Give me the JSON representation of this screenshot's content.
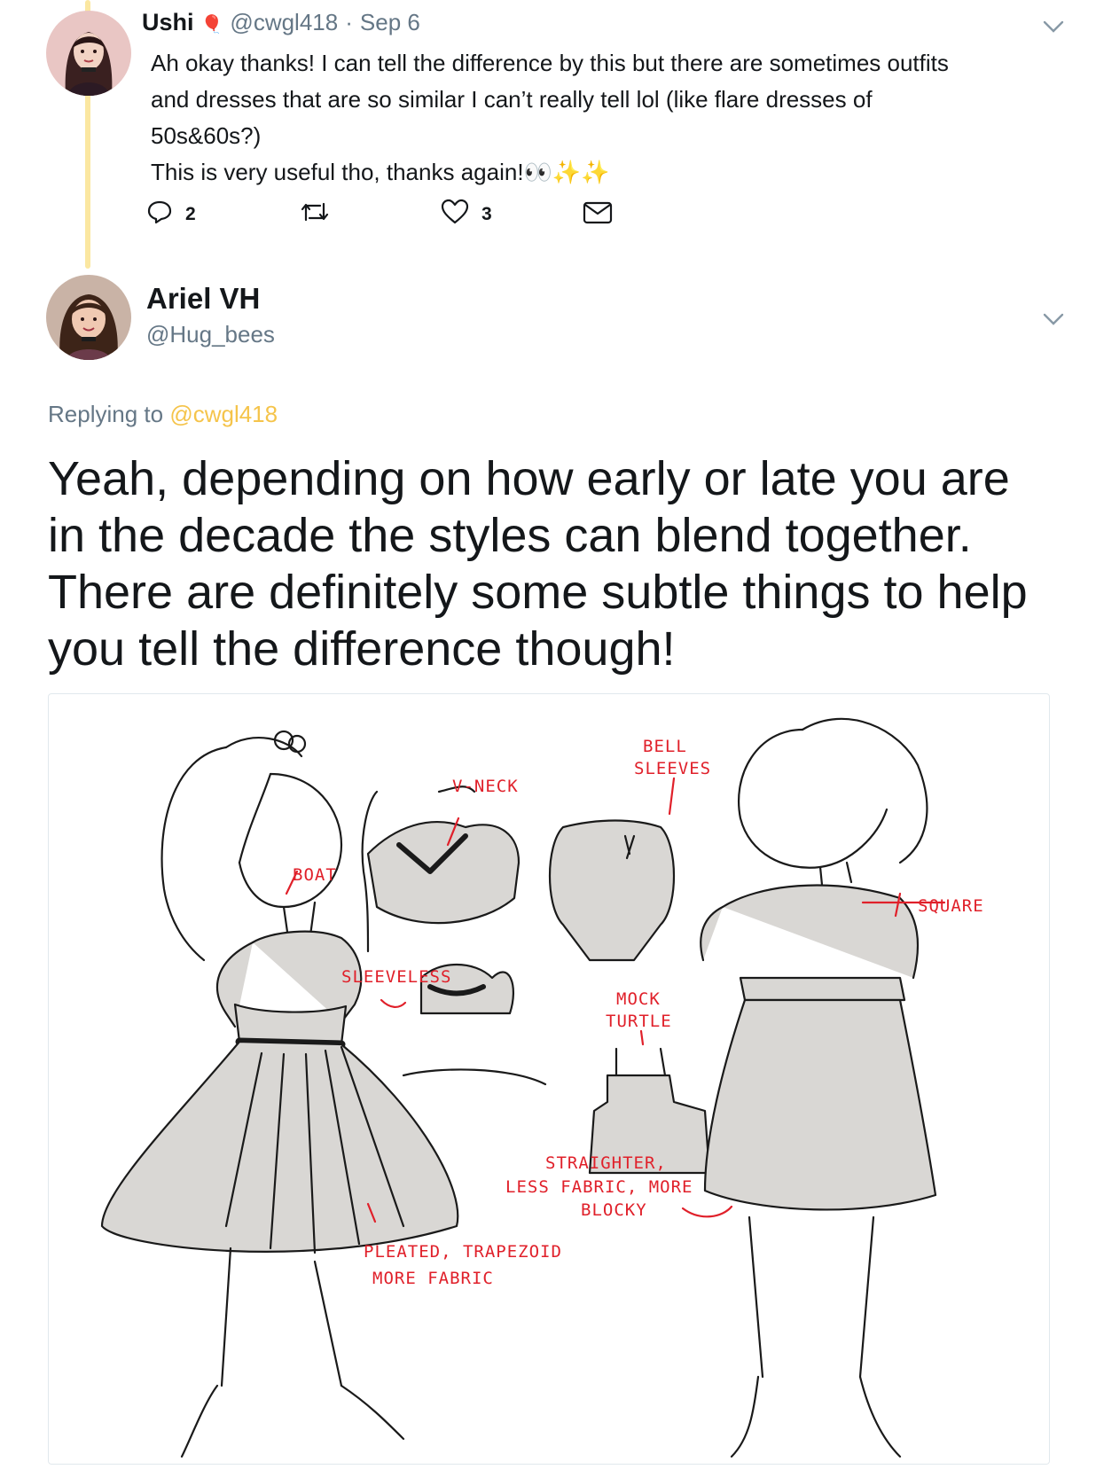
{
  "tweet1": {
    "name": "Ushi",
    "name_emoji": "🎈",
    "handle": "@cwgl418",
    "separator": "·",
    "date": "Sep 6",
    "text": "Ah okay thanks! I can tell the difference by this but there are sometimes outfits\nand dresses that are so similar I can’t really tell lol (like flare dresses of\n50s&60s?)\nThis is very useful tho, thanks again!👀✨✨",
    "actions": {
      "reply_count": "2",
      "like_count": "3"
    }
  },
  "tweet2": {
    "name": "Ariel VH",
    "handle": "@Hug_bees",
    "replying_prefix": "Replying to",
    "replying_to": "@cwgl418",
    "text": "Yeah, depending on how early or late you are in the decade the styles can blend together. There are definitely some subtle things to help you tell the difference though!"
  },
  "illustration": {
    "annotations": {
      "boat": "BOAT",
      "v_neck": "V-NECK",
      "sleeveless": "SLEEVELESS",
      "bell_1": "BELL",
      "bell_2": "SLEEVES",
      "mock_1": "MOCK",
      "mock_2": "TURTLE",
      "square": "SQUARE",
      "straighter_1": "STRAIGHTER,",
      "straighter_2": "LESS FABRIC, MORE",
      "straighter_3": "BLOCKY",
      "pleated_1": "PLEATED, TRAPEZOID",
      "pleated_2": "MORE FABRIC"
    }
  },
  "icons": {
    "reply": "reply-icon",
    "retweet": "retweet-icon",
    "like": "heart-icon",
    "dm": "envelope-icon",
    "menu": "chevron-down-icon"
  },
  "colors": {
    "thread_line": "#fbe7a1",
    "mention": "#f5c44b",
    "muted": "#657786",
    "annotation_red": "#e0202a",
    "sketch_fill": "#d9d7d4"
  }
}
